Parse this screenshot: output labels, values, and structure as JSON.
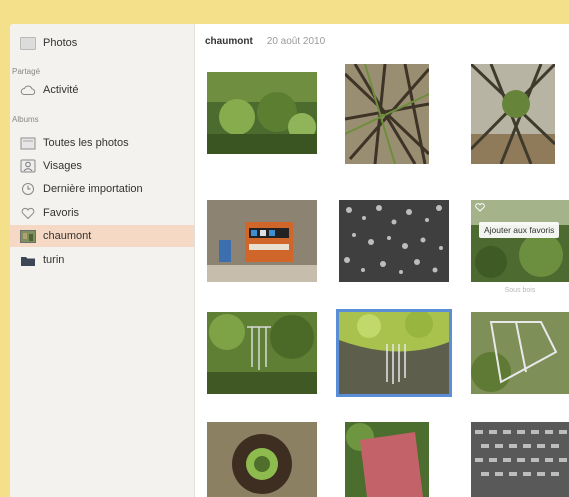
{
  "sidebar": {
    "top_item": {
      "label": "Photos",
      "icon": "photos-icon"
    },
    "section_shared": "Partagé",
    "shared_items": [
      {
        "label": "Activité",
        "icon": "cloud-icon"
      }
    ],
    "section_albums": "Albums",
    "album_items": [
      {
        "label": "Toutes les photos",
        "icon": "album-icon"
      },
      {
        "label": "Visages",
        "icon": "faces-icon"
      },
      {
        "label": "Dernière importation",
        "icon": "clock-icon"
      },
      {
        "label": "Favoris",
        "icon": "heart-icon"
      },
      {
        "label": "chaumont",
        "icon": "album-thumbnail-icon",
        "selected": true
      },
      {
        "label": "turin",
        "icon": "folder-icon"
      }
    ]
  },
  "header": {
    "location": "chaumont",
    "date": "20 août 2010"
  },
  "grid": {
    "tooltip": "Ajouter aux favoris",
    "subcaption": "Sous bois"
  },
  "colors": {
    "background": "#f4df8a",
    "selected_sidebar": "#f6d9c4",
    "selection_border": "#5a8fd8"
  }
}
